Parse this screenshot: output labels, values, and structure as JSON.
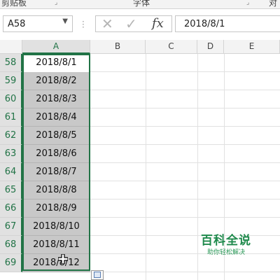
{
  "ribbon": {
    "group_clipboard": "剪贴板",
    "group_font": "字体",
    "group_alignment": "对齐"
  },
  "formula_bar": {
    "name_box": "A58",
    "cancel_icon": "✕",
    "enter_icon": "✓",
    "function_label": "fx",
    "formula_value": "2018/8/1"
  },
  "columns": [
    "A",
    "B",
    "C",
    "D",
    "E"
  ],
  "selected_column": "A",
  "rows": [
    {
      "num": "58",
      "value": "2018/8/1"
    },
    {
      "num": "59",
      "value": "2018/8/2"
    },
    {
      "num": "60",
      "value": "2018/8/3"
    },
    {
      "num": "61",
      "value": "2018/8/4"
    },
    {
      "num": "62",
      "value": "2018/8/5"
    },
    {
      "num": "63",
      "value": "2018/8/6"
    },
    {
      "num": "64",
      "value": "2018/8/7"
    },
    {
      "num": "65",
      "value": "2018/8/8"
    },
    {
      "num": "66",
      "value": "2018/8/9"
    },
    {
      "num": "67",
      "value": "2018/8/10"
    },
    {
      "num": "68",
      "value": "2018/8/11"
    },
    {
      "num": "69",
      "value": "2018/8/12"
    }
  ],
  "watermark": {
    "title": "百科全说",
    "subtitle": "助你轻松解决"
  },
  "colors": {
    "accent": "#217346",
    "selection_fill": "#c8c8c8",
    "header_bg": "#f3f3f3"
  }
}
